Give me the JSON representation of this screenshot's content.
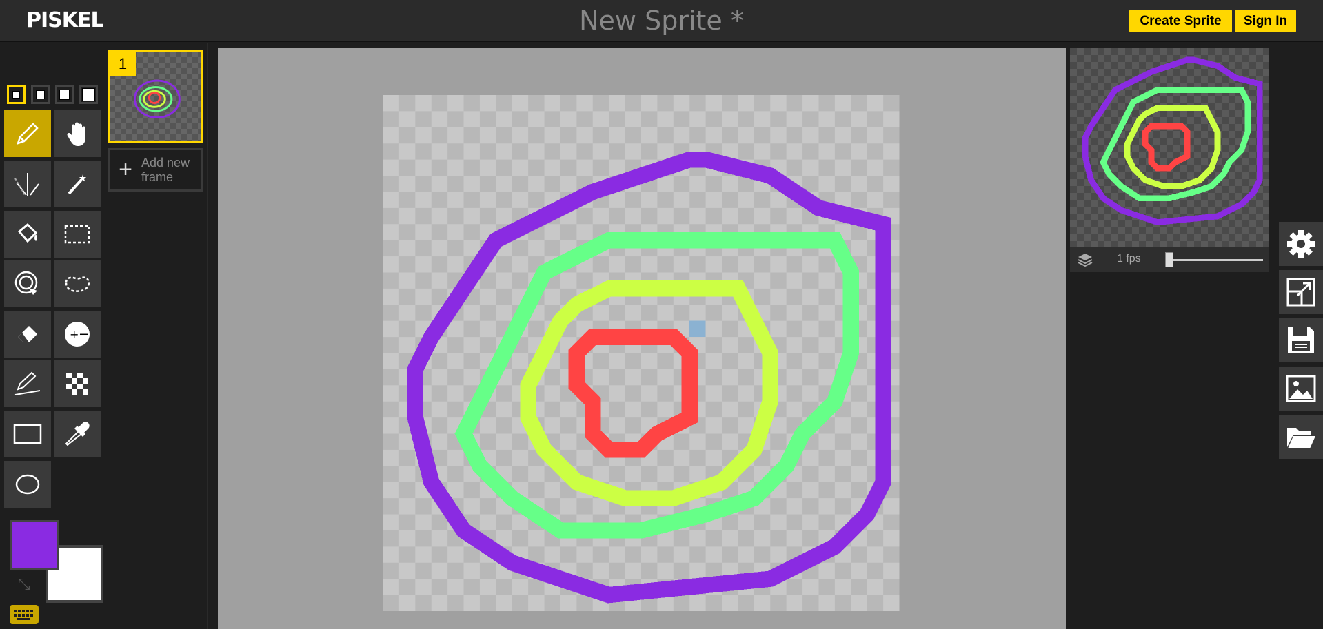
{
  "header": {
    "logo": "PISKEL",
    "title": "New Sprite *",
    "create_label": "Create Sprite",
    "signin_label": "Sign In"
  },
  "tools": {
    "pen_sizes": [
      "1",
      "2",
      "3",
      "4"
    ],
    "items": [
      {
        "name": "pen-tool",
        "icon": "pencil-icon",
        "selected": true
      },
      {
        "name": "move-tool",
        "icon": "hand-icon"
      },
      {
        "name": "vertical-mirror-pen-tool",
        "icon": "mirror-pen-icon"
      },
      {
        "name": "magic-wand-tool",
        "icon": "magic-wand-icon"
      },
      {
        "name": "paint-bucket-tool",
        "icon": "paint-bucket-icon"
      },
      {
        "name": "rectangle-select-tool",
        "icon": "rectangle-select-icon"
      },
      {
        "name": "paint-all-same-color-tool",
        "icon": "color-swap-icon"
      },
      {
        "name": "lasso-select-tool",
        "icon": "lasso-icon"
      },
      {
        "name": "eraser-tool",
        "icon": "eraser-icon"
      },
      {
        "name": "lighten-darken-tool",
        "icon": "lighten-icon"
      },
      {
        "name": "stroke-tool",
        "icon": "line-icon"
      },
      {
        "name": "dithering-tool",
        "icon": "checker-icon"
      },
      {
        "name": "rectangle-tool",
        "icon": "rectangle-icon"
      },
      {
        "name": "color-picker-tool",
        "icon": "eyedropper-icon"
      },
      {
        "name": "circle-tool",
        "icon": "ellipse-icon"
      }
    ],
    "primary_color": "#8a2be2",
    "secondary_color": "#ffffff"
  },
  "frames": {
    "items": [
      {
        "number": "1"
      }
    ],
    "add_label": "Add new frame"
  },
  "preview": {
    "fps_label": "1 fps",
    "fps_value": 1
  },
  "colors": {
    "purple": "#8a2be2",
    "green": "#66ff88",
    "yellow": "#ccff44",
    "red": "#ff4444",
    "accent": "#ffd700"
  }
}
